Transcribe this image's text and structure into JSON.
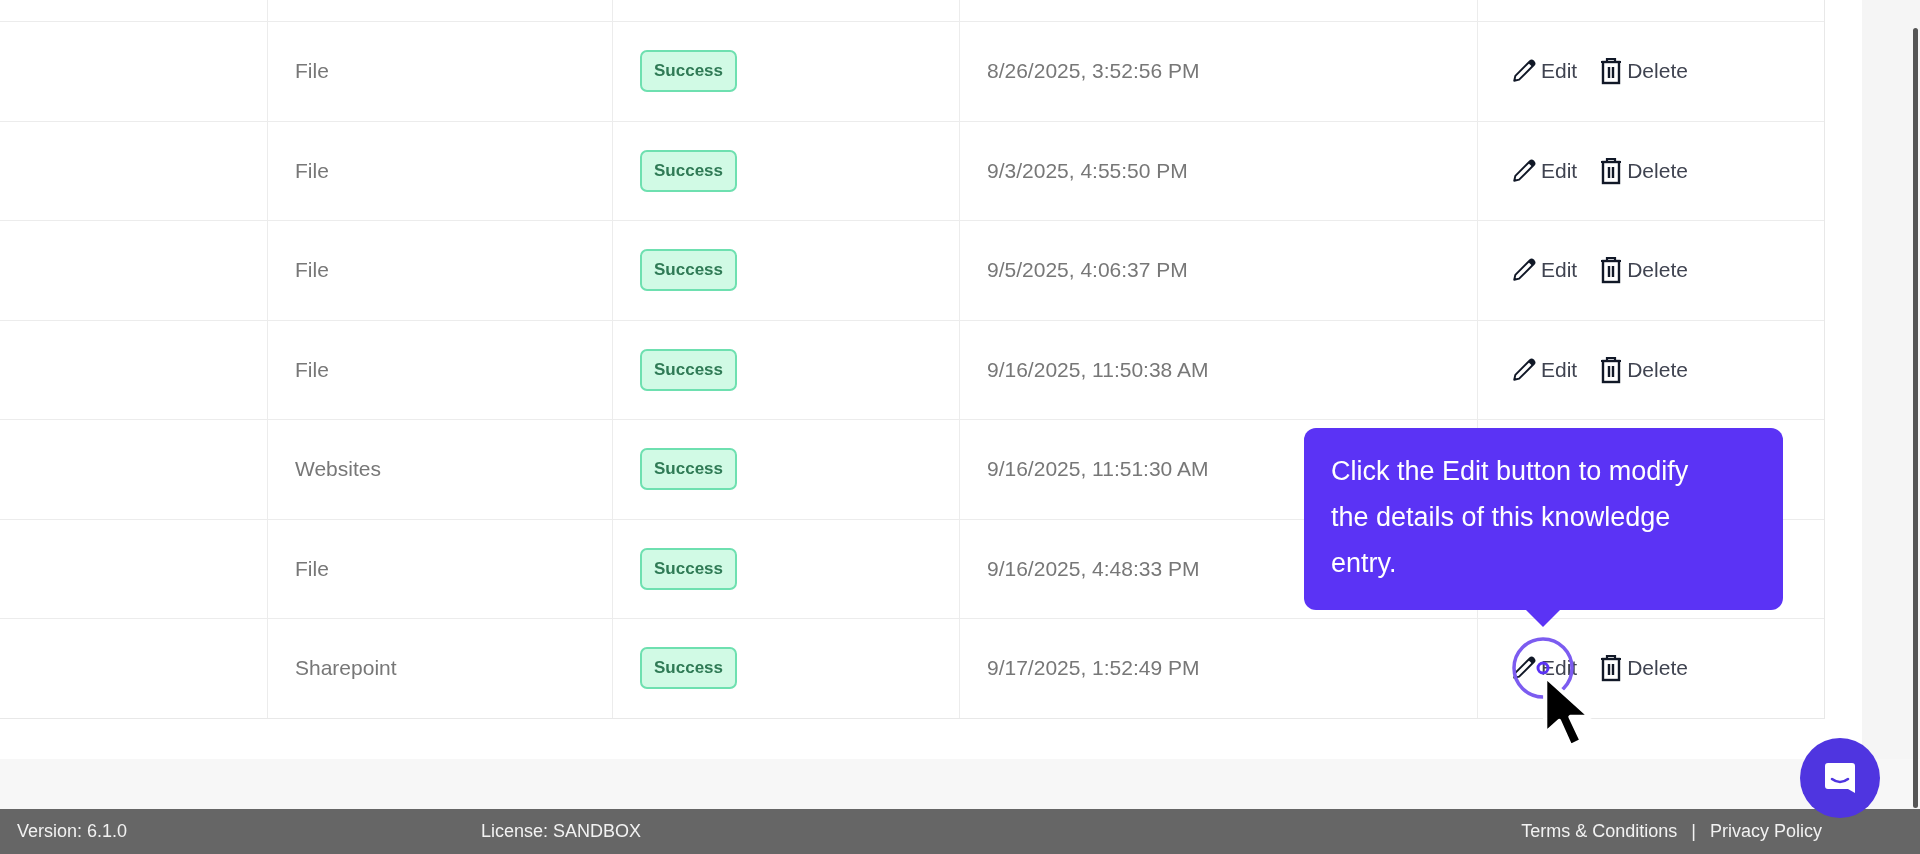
{
  "table": {
    "rows": [
      {
        "type": "File",
        "status": {
          "label": "Success",
          "kind": "success"
        },
        "date": "8/26/2025, 3:52:56 PM",
        "actions": {
          "edit": "Edit",
          "delete": "Delete"
        }
      },
      {
        "type": "File",
        "status": {
          "label": "Success",
          "kind": "success"
        },
        "date": "9/3/2025, 4:55:50 PM",
        "actions": {
          "edit": "Edit",
          "delete": "Delete"
        }
      },
      {
        "type": "File",
        "status": {
          "label": "Success",
          "kind": "success"
        },
        "date": "9/5/2025, 4:06:37 PM",
        "actions": {
          "edit": "Edit",
          "delete": "Delete"
        }
      },
      {
        "type": "File",
        "status": {
          "label": "Success",
          "kind": "success"
        },
        "date": "9/16/2025, 11:50:38 AM",
        "actions": {
          "edit": "Edit",
          "delete": "Delete"
        }
      },
      {
        "type": "Websites",
        "status": {
          "label": "Success",
          "kind": "success"
        },
        "date": "9/16/2025, 11:51:30 AM"
      },
      {
        "type": "File",
        "status": {
          "label": "Success",
          "kind": "success"
        },
        "date": "9/16/2025, 4:48:33 PM"
      },
      {
        "type": "Sharepoint",
        "status": {
          "label": "Success",
          "kind": "success"
        },
        "date": "9/17/2025, 1:52:49 PM",
        "actions": {
          "edit": "Edit",
          "delete": "Delete"
        }
      }
    ]
  },
  "tooltip": {
    "text": "Click the Edit button to modify the details of this knowledge entry."
  },
  "footer": {
    "version": "Version: 6.1.0",
    "license": "License: SANDBOX",
    "links": [
      "Terms & Conditions",
      "Privacy Policy"
    ],
    "separator": "|"
  }
}
